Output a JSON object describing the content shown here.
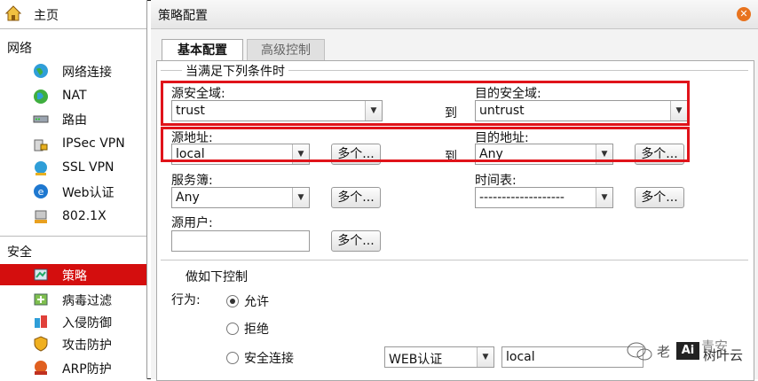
{
  "sidebar": {
    "home": "主页",
    "section_network": "网络",
    "network_items": [
      {
        "label": "网络连接",
        "icon": "globe-icon"
      },
      {
        "label": "NAT",
        "icon": "nat-globe-icon"
      },
      {
        "label": "路由",
        "icon": "router-icon"
      },
      {
        "label": "IPSec VPN",
        "icon": "ipsec-lock-icon"
      },
      {
        "label": "SSL VPN",
        "icon": "ssl-globe-icon"
      },
      {
        "label": "Web认证",
        "icon": "web-auth-icon"
      },
      {
        "label": "802.1X",
        "icon": "network-port-icon"
      }
    ],
    "section_security": "安全",
    "security_items": [
      {
        "label": "策略",
        "icon": "policy-icon",
        "active": true
      },
      {
        "label": "病毒过滤",
        "icon": "virus-filter-icon"
      },
      {
        "label": "入侵防御",
        "icon": "intrusion-prevention-icon"
      },
      {
        "label": "攻击防护",
        "icon": "shield-icon"
      },
      {
        "label": "ARP防护",
        "icon": "arp-icon"
      }
    ]
  },
  "dialog": {
    "title": "策略配置",
    "tabs": [
      "基本配置",
      "高级控制"
    ],
    "group1": "当满足下列条件时",
    "src_zone_label": "源安全域:",
    "src_zone_value": "trust",
    "dst_zone_label": "目的安全域:",
    "dst_zone_value": "untrust",
    "to_1": "到",
    "src_addr_label": "源地址:",
    "src_addr_value": "local",
    "dst_addr_label": "目的地址:",
    "dst_addr_value": "Any",
    "to_2": "到",
    "multi_btn": "多个...",
    "service_label": "服务簿:",
    "service_value": "Any",
    "schedule_label": "时间表:",
    "schedule_value": "-------------------",
    "src_user_label": "源用户:",
    "src_user_value": "",
    "group2": "做如下控制",
    "action_label": "行为:",
    "actions": [
      {
        "label": "允许",
        "selected": true
      },
      {
        "label": "拒绝",
        "selected": false
      },
      {
        "label": "安全连接",
        "selected": false
      }
    ],
    "secure_conn_type": "WEB认证",
    "secure_conn_target": "local"
  },
  "watermark": {
    "text1": "老",
    "text2": "青安",
    "ai": "Ai",
    "text3": "树叶云"
  },
  "colors": {
    "active_nav": "#d40e0e",
    "highlight_border": "#e0131a",
    "close_button": "#e8731e"
  }
}
